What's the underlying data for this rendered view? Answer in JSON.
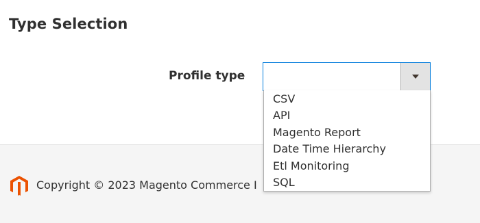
{
  "section": {
    "title": "Type Selection"
  },
  "profile_type": {
    "label": "Profile type",
    "value": "",
    "options": [
      "CSV",
      "API",
      "Magento Report",
      "Date Time Hierarchy",
      "Etl Monitoring",
      "SQL"
    ]
  },
  "footer": {
    "copyright": "Copyright © 2023 Magento Commerce I"
  },
  "colors": {
    "focus_border": "#007bdb",
    "brand_orange": "#eb5202",
    "footer_bg": "#f5f5f5"
  },
  "icons": {
    "toggle": "caret-down-icon",
    "logo": "magento-logo-icon"
  }
}
